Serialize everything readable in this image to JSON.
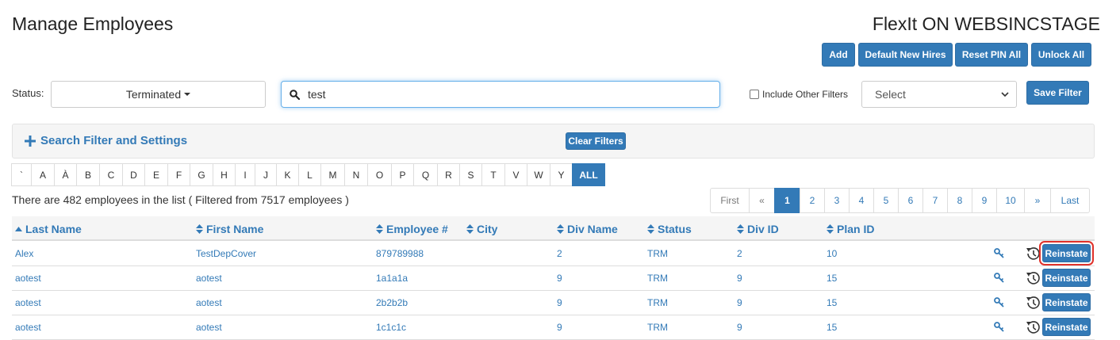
{
  "header": {
    "title": "Manage Employees",
    "app_title": "FlexIt ON WEBSINCSTAGE"
  },
  "toolbar": {
    "add": "Add",
    "default_new_hires": "Default New Hires",
    "reset_pin_all": "Reset PIN All",
    "unlock_all": "Unlock All",
    "save_filter": "Save Filter",
    "clear_filters": "Clear Filters"
  },
  "filters": {
    "status_label": "Status:",
    "status_value": "Terminated",
    "search_value": "test",
    "include_other_filters": "Include Other Filters",
    "include_other_checked": false,
    "select_value": "Select",
    "panel_title": "Search Filter and Settings"
  },
  "alphabet": [
    "`",
    "A",
    "À",
    "B",
    "C",
    "D",
    "E",
    "F",
    "G",
    "H",
    "I",
    "J",
    "K",
    "L",
    "M",
    "N",
    "O",
    "P",
    "Q",
    "R",
    "S",
    "T",
    "V",
    "W",
    "Y",
    "ALL"
  ],
  "alphabet_active": "ALL",
  "summary": "There are 482 employees in the list ( Filtered from 7517 employees )",
  "pagination": {
    "items": [
      "First",
      "«",
      "1",
      "2",
      "3",
      "4",
      "5",
      "6",
      "7",
      "8",
      "9",
      "10",
      "»",
      "Last"
    ],
    "active": "1"
  },
  "table": {
    "columns": [
      "Last Name",
      "First Name",
      "Employee #",
      "City",
      "Div Name",
      "Status",
      "Div ID",
      "Plan ID"
    ],
    "sorted_column": "Last Name",
    "action_label": "Reinstate",
    "rows": [
      {
        "last_name": "Alex",
        "first_name": "TestDepCover",
        "employee_no": "879789988",
        "city": "",
        "div_name": "2",
        "status": "TRM",
        "div_id": "2",
        "plan_id": "10"
      },
      {
        "last_name": "aotest",
        "first_name": "aotest",
        "employee_no": "1a1a1a",
        "city": "",
        "div_name": "9",
        "status": "TRM",
        "div_id": "9",
        "plan_id": "15"
      },
      {
        "last_name": "aotest",
        "first_name": "aotest",
        "employee_no": "2b2b2b",
        "city": "",
        "div_name": "9",
        "status": "TRM",
        "div_id": "9",
        "plan_id": "15"
      },
      {
        "last_name": "aotest",
        "first_name": "aotest",
        "employee_no": "1c1c1c",
        "city": "",
        "div_name": "9",
        "status": "TRM",
        "div_id": "9",
        "plan_id": "15"
      }
    ]
  },
  "colors": {
    "primary": "#337ab7",
    "highlight": "#e0312a"
  },
  "icons": {
    "search": "search-icon",
    "key": "key-icon",
    "history": "history-icon",
    "sort": "sort-icon",
    "plus": "plus-icon"
  }
}
